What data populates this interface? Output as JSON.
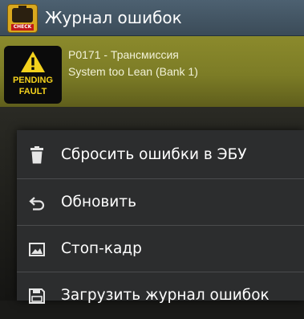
{
  "app": {
    "title": "Журнал ошибок",
    "logo_icon": "check-engine-icon",
    "logo_tag": "CHECK"
  },
  "fault": {
    "badge_icon": "warning-triangle-icon",
    "badge_line1": "PENDING",
    "badge_line2": "FAULT",
    "code_line": "P0171 - Трансмиссия",
    "description": "System too Lean (Bank 1)",
    "color": "#8b8a2c"
  },
  "menu": {
    "items": [
      {
        "label": "Сбросить ошибки в ЭБУ",
        "icon": "trash-icon"
      },
      {
        "label": "Обновить",
        "icon": "undo-arrow-icon"
      },
      {
        "label": "Стоп-кадр",
        "icon": "image-icon"
      },
      {
        "label": "Загрузить журнал ошибок",
        "icon": "save-icon"
      }
    ]
  },
  "colors": {
    "appbar": "#445868",
    "menu_bg": "#2c2d2e",
    "badge_yellow": "#f4d21d"
  }
}
